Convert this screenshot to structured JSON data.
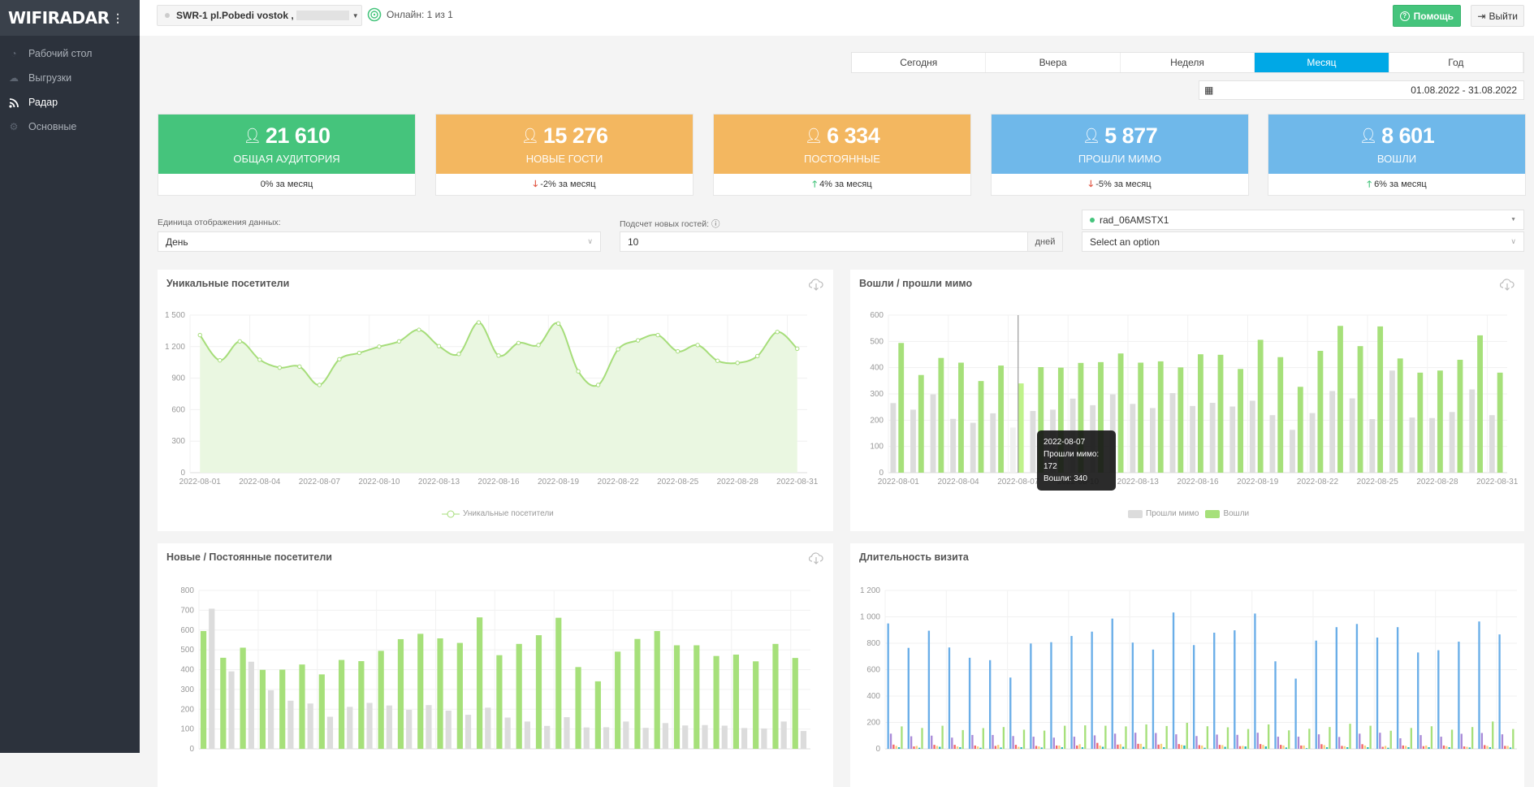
{
  "app": {
    "logo": "WIFIRADAR"
  },
  "sidebar": {
    "items": [
      {
        "label": "Рабочий стол",
        "icon": "dashboard-icon"
      },
      {
        "label": "Выгрузки",
        "icon": "cloud-download-icon"
      },
      {
        "label": "Радар",
        "icon": "radar-signal-icon",
        "active": true
      },
      {
        "label": "Основные",
        "icon": "gear-icon"
      }
    ]
  },
  "header": {
    "device": "SWR-1 pl.Pobedi vostok ,",
    "online": "Онлайн: 1 из 1",
    "help": "Помощь",
    "logout": "Выйти"
  },
  "period": {
    "tabs": [
      "Сегодня",
      "Вчера",
      "Неделя",
      "Месяц",
      "Год"
    ],
    "active": "Месяц",
    "range": "01.08.2022 - 31.08.2022"
  },
  "kpis": [
    {
      "value": "21 610",
      "label": "Общая аудитория",
      "change": "0% за месяц",
      "trend": "none",
      "color": "#45c47c"
    },
    {
      "value": "15 276",
      "label": "Новые гости",
      "change": "-2% за месяц",
      "trend": "down",
      "color": "#f3b760"
    },
    {
      "value": "6 334",
      "label": "Постоянные",
      "change": "4% за месяц",
      "trend": "up",
      "color": "#f3b760"
    },
    {
      "value": "5 877",
      "label": "Прошли мимо",
      "change": "-5% за месяц",
      "trend": "down",
      "color": "#6fb8ea"
    },
    {
      "value": "8 601",
      "label": "Вошли",
      "change": "6% за месяц",
      "trend": "up",
      "color": "#6fb8ea"
    }
  ],
  "filters": {
    "unit_label": "Единица отображения данных:",
    "unit_value": "День",
    "new_label": "Подсчет новых гостей:",
    "new_value": "10",
    "new_suffix": "дней",
    "sensor": "rad_06AMSTX1",
    "option_placeholder": "Select an option"
  },
  "chart_data": [
    {
      "title": "Уникальные посетители",
      "type": "area",
      "ylim": [
        0,
        1500
      ],
      "yticks": [
        "0",
        "300",
        "600",
        "900",
        "1 200",
        "1 500"
      ],
      "xticks": [
        "2022-08-01",
        "2022-08-04",
        "2022-08-07",
        "2022-08-10",
        "2022-08-13",
        "2022-08-16",
        "2022-08-19",
        "2022-08-22",
        "2022-08-25",
        "2022-08-28",
        "2022-08-31"
      ],
      "series": [
        {
          "name": "Уникальные посетители",
          "color": "#a6dd7a",
          "values": [
            1310,
            1070,
            1250,
            1075,
            1000,
            1010,
            835,
            1080,
            1140,
            1200,
            1250,
            1360,
            1205,
            1130,
            1430,
            1115,
            1235,
            1215,
            1420,
            965,
            835,
            1175,
            1260,
            1310,
            1155,
            1215,
            1065,
            1045,
            1110,
            1340,
            1180
          ]
        }
      ],
      "legend": "bottom"
    },
    {
      "title": "Вошли / прошли мимо",
      "type": "bar",
      "ylim": [
        0,
        600
      ],
      "yticks": [
        "0",
        "100",
        "200",
        "300",
        "400",
        "500",
        "600"
      ],
      "xticks": [
        "2022-08-01",
        "2022-08-04",
        "2022-08-07",
        "2022-08-10",
        "2022-08-13",
        "2022-08-16",
        "2022-08-19",
        "2022-08-22",
        "2022-08-25",
        "2022-08-28",
        "2022-08-31"
      ],
      "series": [
        {
          "name": "Прошли мимо",
          "color": "#dcdcdc",
          "values": [
            265,
            240,
            298,
            205,
            190,
            226,
            172,
            235,
            240,
            282,
            257,
            298,
            262,
            246,
            303,
            254,
            266,
            252,
            274,
            219,
            163,
            227,
            311,
            283,
            204,
            389,
            210,
            208,
            231,
            317,
            219
          ]
        },
        {
          "name": "Вошли",
          "color": "#a6e07a",
          "values": [
            494,
            372,
            437,
            419,
            349,
            408,
            340,
            402,
            400,
            418,
            421,
            454,
            419,
            424,
            401,
            451,
            449,
            395,
            506,
            440,
            327,
            464,
            559,
            482,
            557,
            435,
            381,
            389,
            430,
            523,
            381
          ]
        }
      ],
      "legend": "bottom",
      "tooltip": {
        "date": "2022-08-07",
        "line1": "Прошли мимо: 172",
        "line2": "Вошли: 340"
      }
    },
    {
      "title": "Новые / Постоянные посетители",
      "type": "bar",
      "ylim": [
        0,
        800
      ],
      "yticks": [
        "0",
        "100",
        "200",
        "300",
        "400",
        "500",
        "600",
        "700",
        "800"
      ],
      "series": [
        {
          "color": "#a6e07a",
          "values": [
            595,
            460,
            511,
            399,
            400,
            426,
            376,
            449,
            443,
            495,
            554,
            581,
            558,
            535,
            664,
            473,
            530,
            574,
            662,
            413,
            341,
            491,
            555,
            595,
            523,
            523,
            469,
            476,
            442,
            530,
            459
          ]
        },
        {
          "color": "#dcdcdc",
          "values": [
            708,
            391,
            440,
            296,
            243,
            229,
            162,
            212,
            232,
            219,
            197,
            221,
            193,
            172,
            208,
            158,
            138,
            116,
            160,
            108,
            109,
            138,
            106,
            130,
            118,
            120,
            117,
            105,
            103,
            138,
            90
          ]
        }
      ]
    },
    {
      "title": "Длительность визита",
      "type": "bar",
      "ylim": [
        0,
        1200
      ],
      "yticks": [
        "0",
        "200",
        "400",
        "600",
        "800",
        "1 000",
        "1 200"
      ],
      "series": [
        {
          "color": "#6aaee8",
          "values": [
            950,
            765,
            895,
            768,
            690,
            672,
            540,
            798,
            808,
            855,
            888,
            987,
            805,
            752,
            1033,
            786,
            880,
            898,
            1025,
            663,
            532,
            820,
            922,
            946,
            843,
            922,
            730,
            747,
            812,
            965,
            867
          ]
        },
        {
          "color": "#a98ad8",
          "values": [
            115,
            95,
            100,
            85,
            105,
            105,
            97,
            92,
            85,
            92,
            102,
            115,
            122,
            120,
            110,
            97,
            108,
            106,
            122,
            92,
            92,
            110,
            90,
            115,
            122,
            80,
            104,
            92,
            114,
            120,
            110
          ]
        },
        {
          "color": "#f3646b",
          "values": [
            32,
            18,
            30,
            30,
            25,
            22,
            30,
            22,
            25,
            25,
            45,
            32,
            38,
            32,
            36,
            28,
            30,
            20,
            36,
            30,
            25,
            35,
            22,
            35,
            15,
            25,
            20,
            25,
            18,
            28,
            22
          ]
        },
        {
          "color": "#f8d27a",
          "values": [
            22,
            22,
            22,
            18,
            18,
            30,
            15,
            18,
            25,
            35,
            25,
            35,
            38,
            38,
            30,
            25,
            28,
            22,
            30,
            25,
            25,
            28,
            20,
            25,
            22,
            22,
            25,
            20,
            15,
            22,
            22
          ]
        },
        {
          "color": "#1fb5b5",
          "values": [
            12,
            8,
            15,
            12,
            8,
            10,
            12,
            10,
            12,
            12,
            15,
            15,
            14,
            12,
            25,
            8,
            15,
            18,
            18,
            10,
            5,
            12,
            12,
            12,
            8,
            12,
            12,
            12,
            10,
            12,
            10
          ]
        },
        {
          "color": "#a6e07a",
          "values": [
            170,
            158,
            175,
            142,
            157,
            165,
            145,
            138,
            175,
            178,
            175,
            170,
            185,
            173,
            197,
            171,
            163,
            150,
            185,
            140,
            152,
            165,
            190,
            175,
            137,
            158,
            171,
            145,
            165,
            207,
            150
          ]
        }
      ]
    }
  ]
}
